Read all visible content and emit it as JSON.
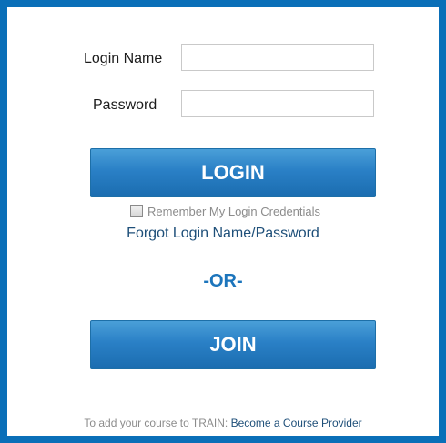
{
  "form": {
    "login_name_label": "Login Name",
    "login_name_value": "",
    "password_label": "Password",
    "password_value": "",
    "login_button": "LOGIN",
    "remember_label": "Remember My Login Credentials",
    "remember_checked": false,
    "forgot_link": "Forgot Login Name/Password",
    "or_separator": "-OR-",
    "join_button": "JOIN"
  },
  "footer": {
    "prefix": "To add your course to TRAIN:",
    "link": "Become a Course Provider"
  },
  "colors": {
    "frame_border": "#0a6fb8",
    "button_blue": "#2a80c6",
    "or_text": "#1c75bc",
    "link_text": "#1e4f79",
    "muted_text": "#8c8c8c"
  }
}
